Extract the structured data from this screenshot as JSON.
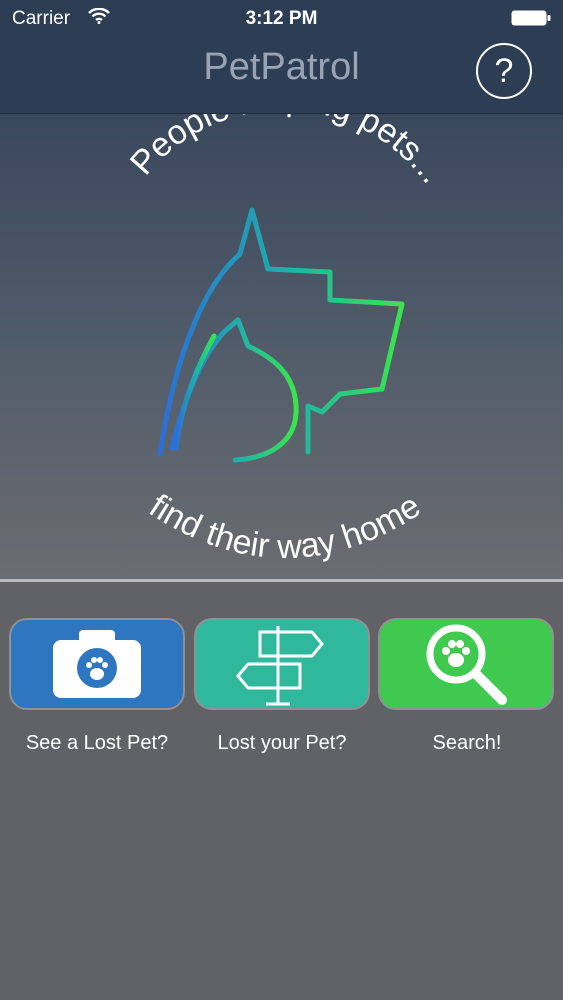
{
  "status_bar": {
    "carrier": "Carrier",
    "time": "3:12 PM",
    "icons": [
      "wifi-icon",
      "battery-icon"
    ]
  },
  "nav": {
    "title": "PetPatrol",
    "help_label": "?"
  },
  "hero": {
    "tagline_top": "People helping pets...",
    "tagline_bottom": "find their way home",
    "logo": "dog-cat-logo",
    "colors": {
      "blue": "#2a6fd8",
      "teal": "#1fb3a8",
      "green": "#39e64a"
    }
  },
  "actions": [
    {
      "label": "See a Lost Pet?",
      "icon": "camera-paw-icon",
      "color": "#2e76c0"
    },
    {
      "label": "Lost your Pet?",
      "icon": "signpost-icon",
      "color": "#2fb89c"
    },
    {
      "label": "Search!",
      "icon": "magnifier-paw-icon",
      "color": "#3fc94e"
    }
  ]
}
